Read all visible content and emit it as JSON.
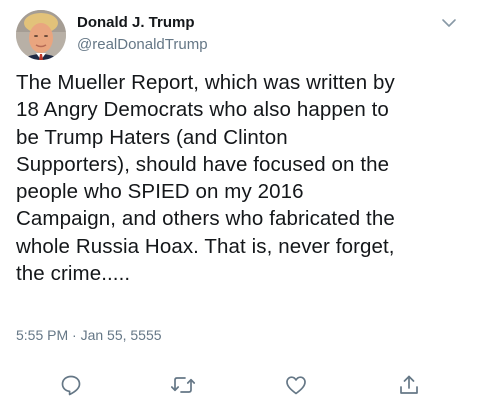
{
  "user": {
    "display_name": "Donald J. Trump",
    "handle": "@realDonaldTrump"
  },
  "tweet": {
    "text": "The Mueller Report, which was written by\n18 Angry Democrats who also happen to\nbe Trump Haters (and Clinton\nSupporters), should have focused on the\npeople who SPIED on my 2016\nCampaign, and others who fabricated the\nwhole Russia Hoax. That is, never forget,\nthe crime.....",
    "timestamp": "5:55 PM · Jan 55, 5555"
  },
  "icons": {
    "menu": "chevron-down-icon",
    "reply": "reply-icon",
    "retweet": "retweet-icon",
    "like": "heart-icon",
    "share": "share-icon"
  },
  "colors": {
    "text": "#14171a",
    "secondary": "#657786"
  }
}
